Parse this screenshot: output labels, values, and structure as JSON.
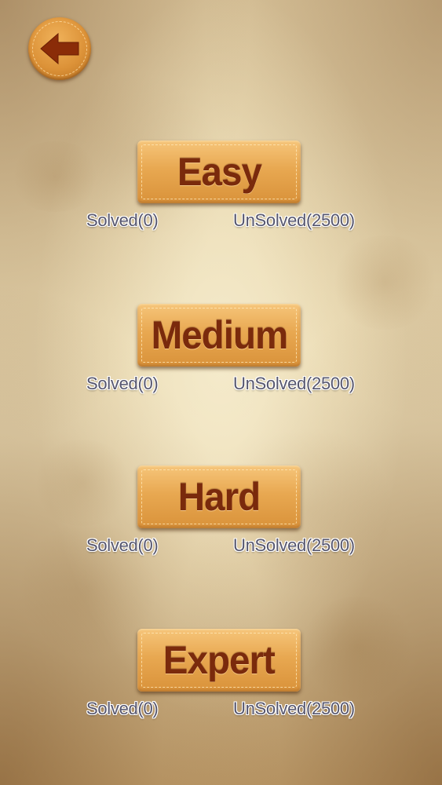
{
  "back_button": {
    "icon": "arrow-left-icon",
    "color": "#dc9238",
    "arrow_color": "#8a2c08"
  },
  "levels": [
    {
      "label": "Easy",
      "solved": "Solved(0)",
      "unsolved": "UnSolved(2500)"
    },
    {
      "label": "Medium",
      "solved": "Solved(0)",
      "unsolved": "UnSolved(2500)"
    },
    {
      "label": "Hard",
      "solved": "Solved(0)",
      "unsolved": "UnSolved(2500)"
    },
    {
      "label": "Expert",
      "solved": "Solved(0)",
      "unsolved": "UnSolved(2500)"
    }
  ],
  "colors": {
    "background": "#e6d5ad",
    "button": "#e8a851",
    "button_text": "#7a2a0c",
    "stat_text": "#56566e"
  }
}
